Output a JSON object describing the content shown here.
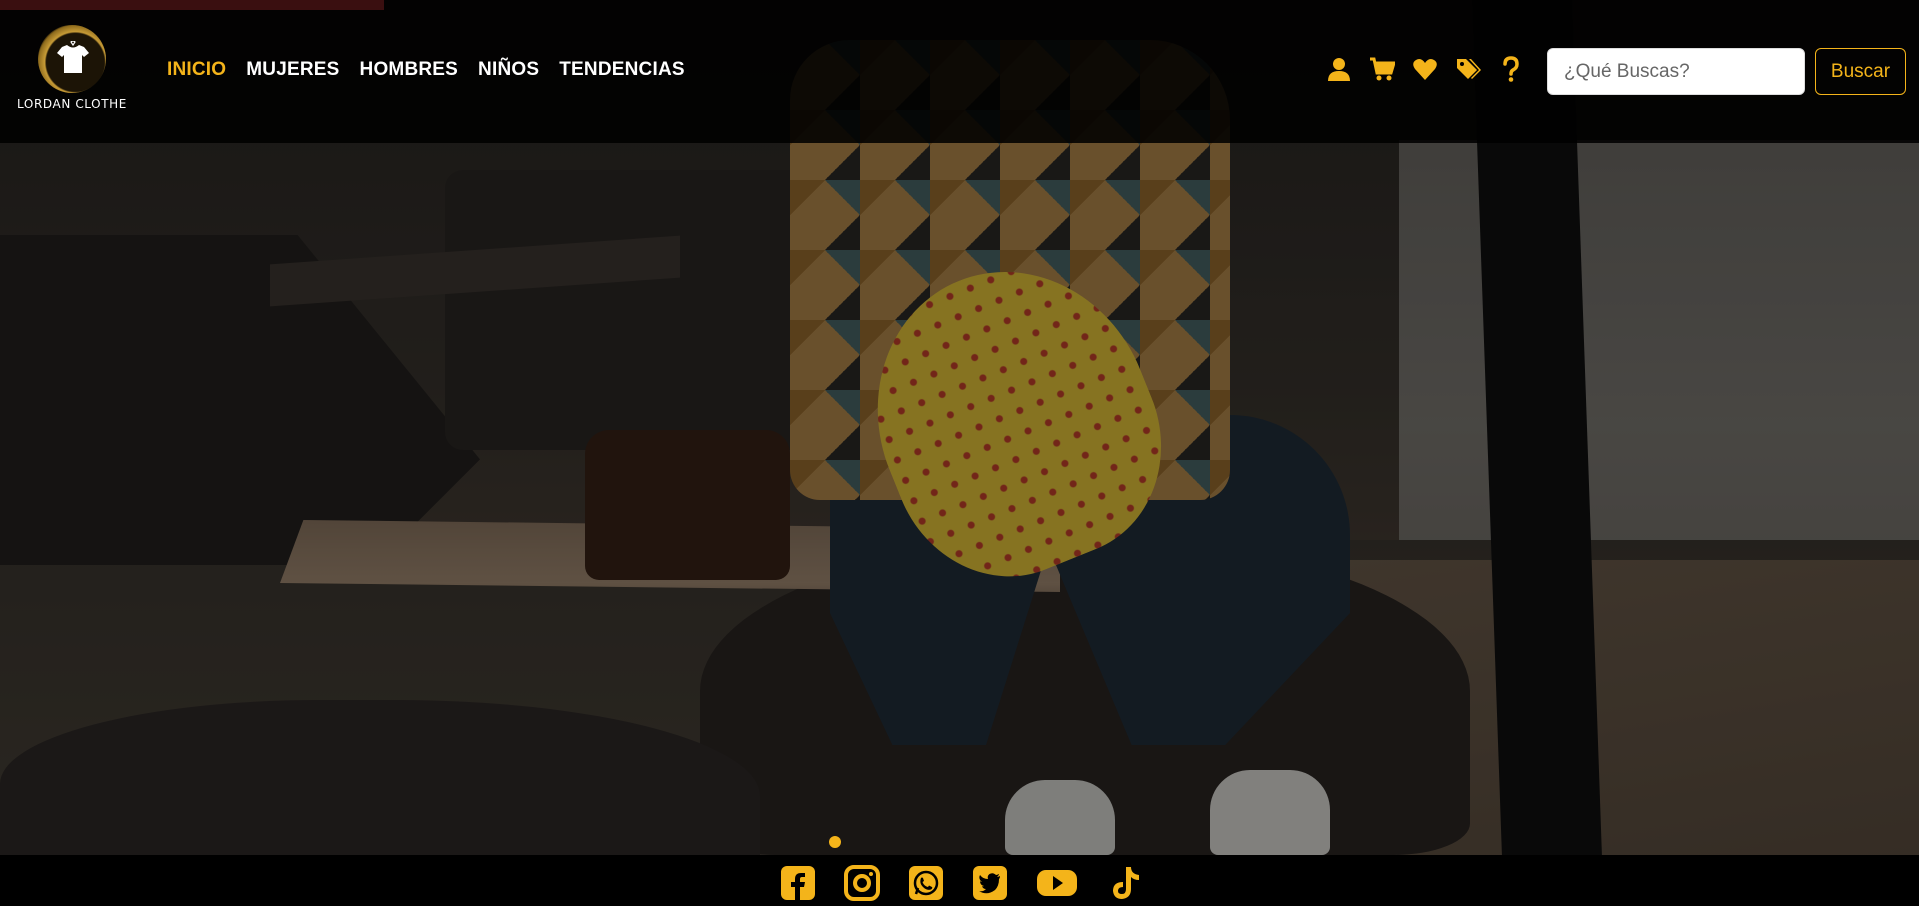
{
  "brand": {
    "name": "LORDAN CLOTHE"
  },
  "nav": {
    "items": [
      {
        "label": "INICIO",
        "active": true
      },
      {
        "label": "MUJERES",
        "active": false
      },
      {
        "label": "HOMBRES",
        "active": false
      },
      {
        "label": "NIÑOS",
        "active": false
      },
      {
        "label": "TENDENCIAS",
        "active": false
      }
    ]
  },
  "header_icons": [
    "user-icon",
    "cart-icon",
    "heart-icon",
    "tags-icon",
    "question-icon"
  ],
  "search": {
    "placeholder": "¿Qué Buscas?",
    "value": "",
    "button_label": "Buscar"
  },
  "carousel": {
    "slides": 1,
    "active_index": 0
  },
  "social": [
    "facebook-icon",
    "instagram-icon",
    "whatsapp-icon",
    "twitter-icon",
    "youtube-icon",
    "tiktok-icon"
  ],
  "colors": {
    "accent": "#f4b41a",
    "header_bg": "#000000",
    "text": "#ffffff"
  }
}
